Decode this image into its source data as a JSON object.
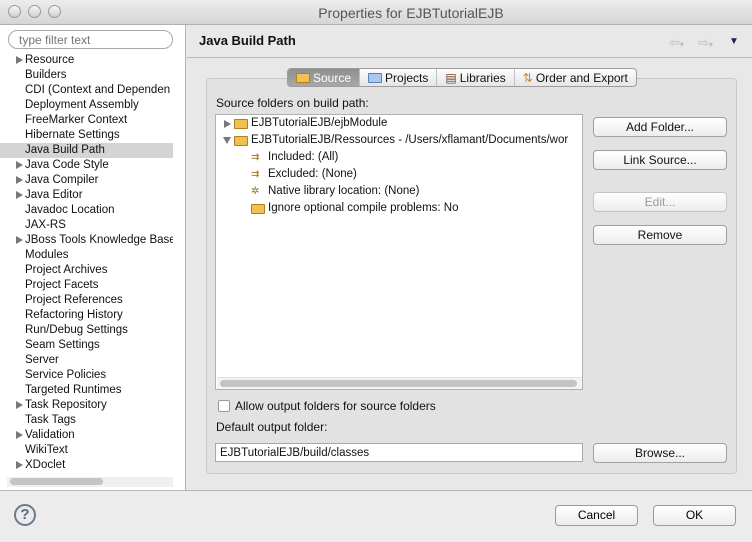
{
  "window": {
    "title": "Properties for EJBTutorialEJB"
  },
  "sidebar": {
    "filter_placeholder": "type filter text",
    "items": [
      {
        "label": "Resource",
        "expandable": true
      },
      {
        "label": "Builders",
        "expandable": false
      },
      {
        "label": "CDI (Context and Dependen",
        "expandable": false
      },
      {
        "label": "Deployment Assembly",
        "expandable": false
      },
      {
        "label": "FreeMarker Context",
        "expandable": false
      },
      {
        "label": "Hibernate Settings",
        "expandable": false
      },
      {
        "label": "Java Build Path",
        "expandable": false,
        "selected": true
      },
      {
        "label": "Java Code Style",
        "expandable": true
      },
      {
        "label": "Java Compiler",
        "expandable": true
      },
      {
        "label": "Java Editor",
        "expandable": true
      },
      {
        "label": "Javadoc Location",
        "expandable": false
      },
      {
        "label": "JAX-RS",
        "expandable": false
      },
      {
        "label": "JBoss Tools Knowledge Base",
        "expandable": true
      },
      {
        "label": "Modules",
        "expandable": false
      },
      {
        "label": "Project Archives",
        "expandable": false
      },
      {
        "label": "Project Facets",
        "expandable": false
      },
      {
        "label": "Project References",
        "expandable": false
      },
      {
        "label": "Refactoring History",
        "expandable": false
      },
      {
        "label": "Run/Debug Settings",
        "expandable": false
      },
      {
        "label": "Seam Settings",
        "expandable": false
      },
      {
        "label": "Server",
        "expandable": false
      },
      {
        "label": "Service Policies",
        "expandable": false
      },
      {
        "label": "Targeted Runtimes",
        "expandable": false
      },
      {
        "label": "Task Repository",
        "expandable": true
      },
      {
        "label": "Task Tags",
        "expandable": false
      },
      {
        "label": "Validation",
        "expandable": true
      },
      {
        "label": "WikiText",
        "expandable": false
      },
      {
        "label": "XDoclet",
        "expandable": true
      }
    ]
  },
  "page": {
    "title": "Java Build Path",
    "tabs": [
      {
        "label": "Source",
        "active": true
      },
      {
        "label": "Projects"
      },
      {
        "label": "Libraries"
      },
      {
        "label": "Order and Export"
      }
    ],
    "source_label": "Source folders on build path:",
    "tree": [
      {
        "label": "EJBTutorialEJB/ejbModule",
        "icon": "package-folder-icon"
      },
      {
        "label": "EJBTutorialEJB/Ressources - /Users/xflamant/Documents/wor",
        "icon": "package-folder-icon"
      },
      {
        "label": "Included: (All)",
        "icon": "inclusion-filter-icon"
      },
      {
        "label": "Excluded: (None)",
        "icon": "exclusion-filter-icon"
      },
      {
        "label": "Native library location: (None)",
        "icon": "native-library-icon"
      },
      {
        "label": "Ignore optional compile problems: No",
        "icon": "ignore-problems-icon"
      }
    ],
    "buttons": {
      "add_folder": "Add Folder...",
      "link_source": "Link Source...",
      "edit": "Edit...",
      "remove": "Remove",
      "browse": "Browse..."
    },
    "allow_output_label": "Allow output folders for source folders",
    "allow_output_checked": false,
    "default_output_label": "Default output folder:",
    "default_output_value": "EJBTutorialEJB/build/classes"
  },
  "footer": {
    "help": "?",
    "cancel": "Cancel",
    "ok": "OK"
  }
}
